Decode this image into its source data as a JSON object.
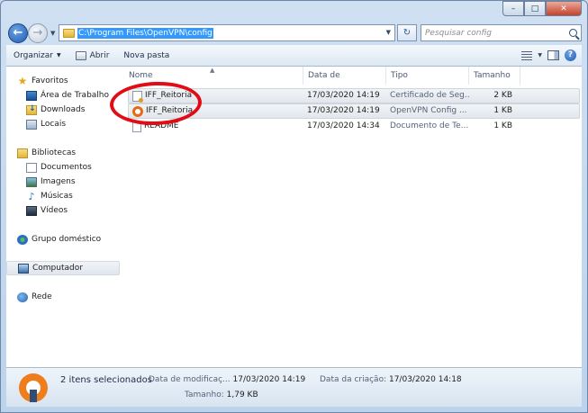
{
  "window": {
    "minimize_label": "–",
    "maximize_label": "□",
    "close_label": "✕"
  },
  "nav": {
    "back_label": "←",
    "forward_label": "→",
    "address": "C:\\Program Files\\OpenVPN\\config",
    "refresh_label": "↻",
    "search_placeholder": "Pesquisar config"
  },
  "command_bar": {
    "organize": "Organizar",
    "open": "Abrir",
    "new_folder": "Nova pasta"
  },
  "sidebar": {
    "favorites": {
      "label": "Favoritos",
      "items": [
        "Área de Trabalho",
        "Downloads",
        "Locais"
      ]
    },
    "libraries": {
      "label": "Bibliotecas",
      "items": [
        "Documentos",
        "Imagens",
        "Músicas",
        "Vídeos"
      ]
    },
    "homegroup": "Grupo doméstico",
    "computer": "Computador",
    "network": "Rede"
  },
  "columns": {
    "name": "Nome",
    "date": "Data de modificaç...",
    "type": "Tipo",
    "size": "Tamanho"
  },
  "files": [
    {
      "name": "IFF_Reitoria",
      "date": "17/03/2020 14:19",
      "type": "Certificado de Seg...",
      "size": "2 KB",
      "icon": "certificate-icon",
      "selected": true
    },
    {
      "name": "IFF_Reitoria",
      "date": "17/03/2020 14:19",
      "type": "OpenVPN Config ...",
      "size": "1 KB",
      "icon": "openvpn-icon",
      "selected": true
    },
    {
      "name": "README",
      "date": "17/03/2020 14:34",
      "type": "Documento de Te...",
      "size": "1 KB",
      "icon": "text-document-icon",
      "selected": false
    }
  ],
  "details": {
    "selection": "2 itens selecionados",
    "modified_label": "Data de modificaç...",
    "modified_value": "17/03/2020 14:19",
    "created_label": "Data da criação:",
    "created_value": "17/03/2020 14:18",
    "size_label": "Tamanho:",
    "size_value": "1,79 KB"
  },
  "colors": {
    "highlight_ring": "#e10c15",
    "address_selection": "#3399ff"
  }
}
